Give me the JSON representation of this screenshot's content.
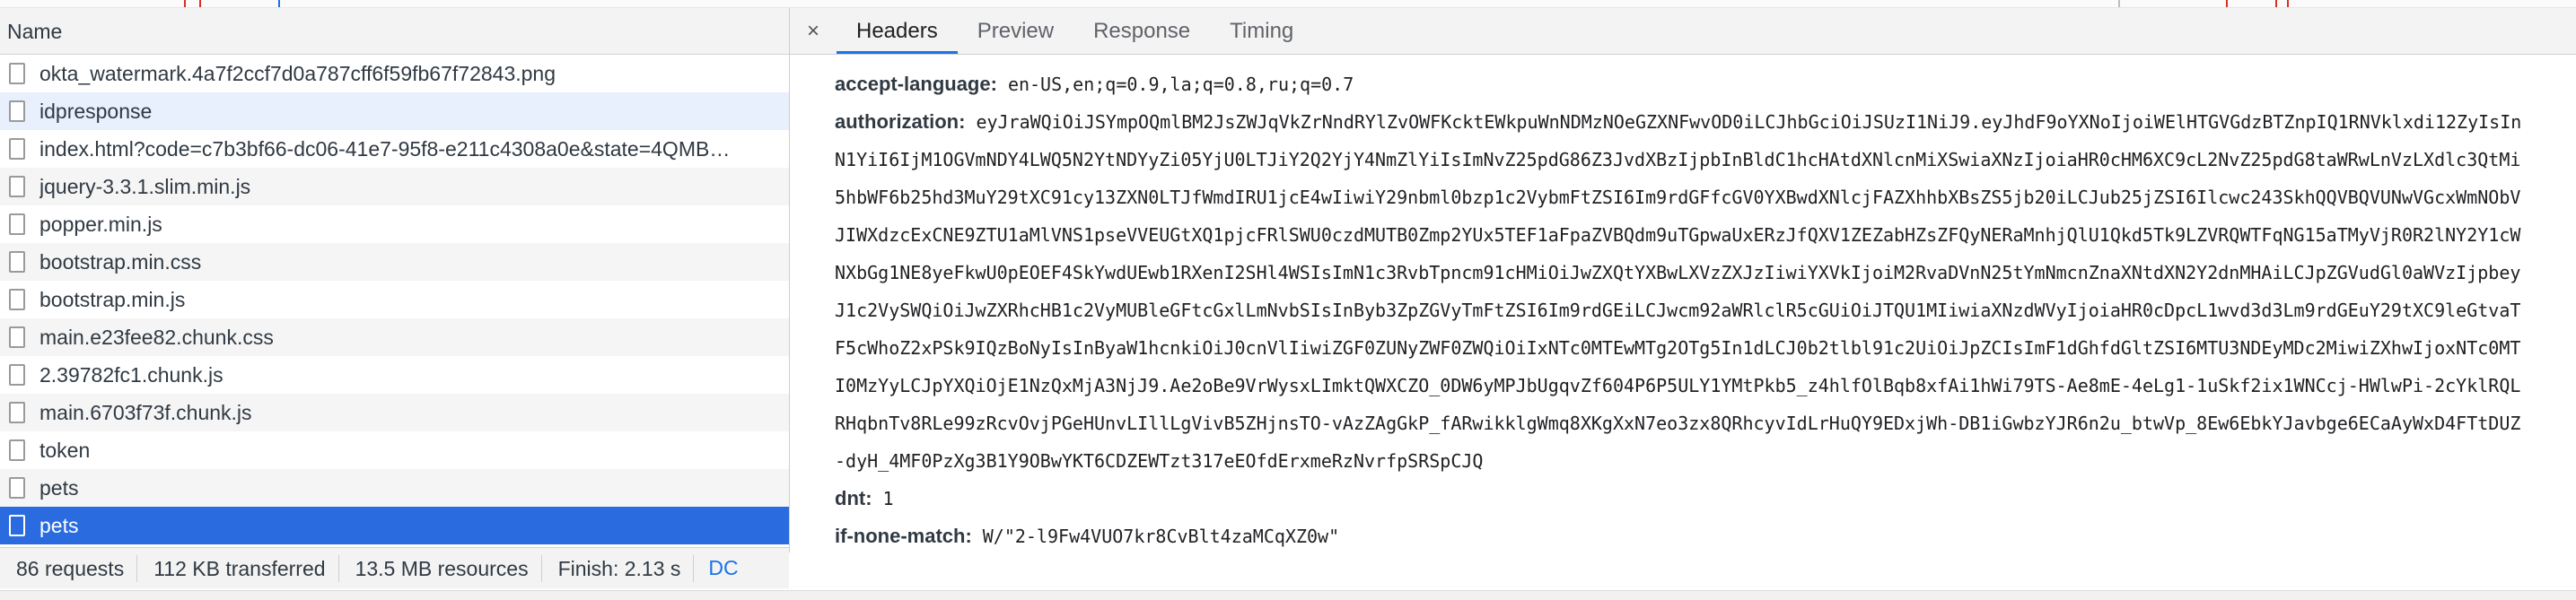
{
  "network_list": {
    "column_header": "Name",
    "rows": [
      {
        "name": "okta_watermark.4a7f2ccf7d0a787cff6f59fb67f72843.png",
        "state": "normal"
      },
      {
        "name": "idpresponse",
        "state": "hover"
      },
      {
        "name": "index.html?code=c7b3bf66-dc06-41e7-95f8-e211c4308a0e&state=4QMB…",
        "state": "normal"
      },
      {
        "name": "jquery-3.3.1.slim.min.js",
        "state": "alt"
      },
      {
        "name": "popper.min.js",
        "state": "normal"
      },
      {
        "name": "bootstrap.min.css",
        "state": "alt"
      },
      {
        "name": "bootstrap.min.js",
        "state": "normal"
      },
      {
        "name": "main.e23fee82.chunk.css",
        "state": "alt"
      },
      {
        "name": "2.39782fc1.chunk.js",
        "state": "normal"
      },
      {
        "name": "main.6703f73f.chunk.js",
        "state": "alt"
      },
      {
        "name": "token",
        "state": "normal"
      },
      {
        "name": "pets",
        "state": "alt"
      },
      {
        "name": "pets",
        "state": "selected"
      }
    ]
  },
  "status_bar": {
    "requests": "86 requests",
    "transferred": "112 KB transferred",
    "resources": "13.5 MB resources",
    "finish": "Finish: 2.13 s",
    "dom": "DC"
  },
  "detail_panel": {
    "close_glyph": "×",
    "tabs": [
      "Headers",
      "Preview",
      "Response",
      "Timing"
    ],
    "active_tab": "Headers",
    "headers": {
      "accept_language_key": "accept-language:",
      "accept_language_value": "en-US,en;q=0.9,la;q=0.8,ru;q=0.7",
      "authorization_key": "authorization:",
      "authorization_value": "eyJraWQiOiJSYmpOQmlBM2JsZWJqVkZrNndRYlZvOWFKcktEWkpuWnNDMzNOeGZXNFwvOD0iLCJhbGciOiJSUzI1NiJ9.eyJhdF9oYXNoIjoiWElHTGVGdzBTZnpIQ1RNVklxdi12ZyIsInN1YiI6IjM1OGVmNDY4LWQ5N2YtNDYyZi05YjU0LTJiY2Q2YjY4NmZlYiIsImNvZ25pdG86Z3JvdXBzIjpbInBldC1hcHAtdXNlcnMiXSwiaXNzIjoiaHR0cHM6XC9cL2NvZ25pdG8taWRwLnVzLXdlc3QtMi5hbWF6b25hd3MuY29tXC91cy13ZXN0LTJfWmdIRU1jcE4wIiwiY29nbml0bzp1c2VybmFtZSI6Im9rdGFfcGV0YXBwdXNlcjFAZXhhbXBsZS5jb20iLCJub25jZSI6Ilcwc243SkhQQVBQVUNwVGcxWmNObVJIWXdzcExCNE9ZTU1aMlVNS1pseVVEUGtXQ1pjcFRlSWU0czdMUTB0Zmp2YUx5TEF1aFpaZVBQdm9uTGpwaUxERzJfQXV1ZEZabHZsZFQyNERaMnhjQlU1Qkd5Tk9LZVRQWTFqNG15aTMyVjR0R2lNY2Y1cWNXbGg1NE8yeFkwU0pEOEF4SkYwdUEwb1RXenI2SHl4WSIsImN1c3RvbTpncm91cHMiOiJwZXQtYXBwLXVzZXJzIiwiYXVkIjoiM2RvaDVnN25tYmNmcnZnaXNtdXN2Y2dnMHAiLCJpZGVudGl0aWVzIjpbeyJ1c2VySWQiOiJwZXRhcHB1c2VyMUBleGFtcGxlLmNvbSIsInByb3ZpZGVyTmFtZSI6Im9rdGEiLCJwcm92aWRlclR5cGUiOiJTQU1MIiwiaXNzdWVyIjoiaHR0cDpcL1wvd3d3Lm9rdGEuY29tXC9leGtvaTF5cWhoZ2xPSk9IQzBoNyIsInByaW1hcnkiOiJ0cnVlIiwiZGF0ZUNyZWF0ZWQiOiIxNTc0MTEwMTg2OTg5In1dLCJ0b2tlbl91c2UiOiJpZCIsImF1dGhfdGltZSI6MTU3NDEyMDc2MiwiZXhwIjoxNTc0MTI0MzYyLCJpYXQiOjE1NzQxMjA3NjJ9.Ae2oBe9VrWysxLImktQWXCZO_0DW6yMPJbUgqvZf604P6P5ULY1YMtPkb5_z4hlfOlBqb8xfAi1hWi79TS-Ae8mE-4eLg1-1uSkf2ix1WNCcj-HWlwPi-2cYklRQLRHqbnTv8RLe99zRcvOvjPGeHUnvLIllLgVivB5ZHjnsTO-vAzZAgGkP_fARwikklgWmq8XKgXxN7eo3zx8QRhcyvIdLrHuQY9EDxjWh-DB1iGwbzYJR6n2u_btwVp_8Ew6EbkYJavbge6ECaAyWxD4FTtDUZ-dyH_4MF0PzXg3B1Y9OBwYKT6CDZEWTzt317eEOfdErxmeRzNvrfpSRSpCJQ",
      "dnt_key": "dnt:",
      "dnt_value": "1",
      "if_none_match_key": "if-none-match:",
      "if_none_match_value": "W/\"2-l9Fw4VUO7kr8CvBlt4zaMCqXZ0w\""
    }
  }
}
